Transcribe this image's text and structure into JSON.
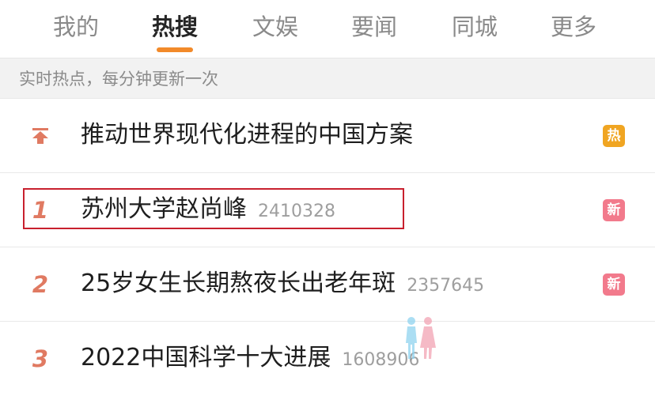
{
  "tabs": [
    {
      "label": "我的"
    },
    {
      "label": "热搜",
      "active": true
    },
    {
      "label": "文娱"
    },
    {
      "label": "要闻"
    },
    {
      "label": "同城"
    },
    {
      "label": "更多"
    }
  ],
  "subheader": {
    "text": "实时热点，每分钟更新一次"
  },
  "items": [
    {
      "rank": "",
      "rank_icon": "pin-top-icon",
      "title": "推动世界现代化进程的中国方案",
      "count": "",
      "badge": "热",
      "badge_color": "#f0a522"
    },
    {
      "rank": "1",
      "title": "苏州大学赵尚峰",
      "count": "2410328",
      "badge": "新",
      "badge_color": "#f27a8c"
    },
    {
      "rank": "2",
      "title": "25岁女生长期熬夜长出老年斑",
      "count": "2357645",
      "badge": "新",
      "badge_color": "#f27a8c"
    },
    {
      "rank": "3",
      "title": "2022中国科学十大进展",
      "count": "1608906",
      "badge": "",
      "badge_color": ""
    }
  ],
  "colors": {
    "accent": "#f28a2a",
    "rank": "#e07a62",
    "hot_badge": "#f0a522",
    "new_badge": "#f27a8c",
    "highlight_box": "#c8202e"
  }
}
